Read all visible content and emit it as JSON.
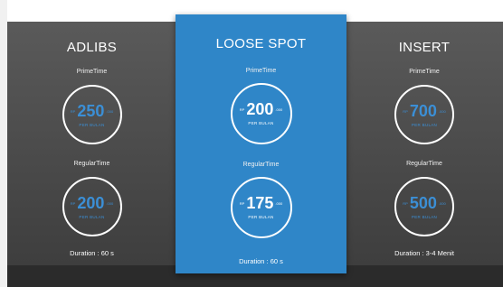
{
  "columns": [
    {
      "title": "ADLIBS",
      "prime_label": "PrimeTime",
      "prime": {
        "prefix": "RP",
        "value": "250",
        "suffix": ".000",
        "per": "PER BULAN"
      },
      "regular_label": "RegularTime",
      "regular": {
        "prefix": "RP",
        "value": "200",
        "suffix": ".000",
        "per": "PER BULAN"
      },
      "duration": "Duration : 60 s"
    },
    {
      "title": "LOOSE SPOT",
      "prime_label": "PrimeTime",
      "prime": {
        "prefix": "RP",
        "value": "200",
        "suffix": ".000",
        "per": "PER BULAN"
      },
      "regular_label": "RegularTime",
      "regular": {
        "prefix": "RP",
        "value": "175",
        "suffix": ".000",
        "per": "PER BULAN"
      },
      "duration": "Duration : 60 s"
    },
    {
      "title": "INSERT",
      "prime_label": "PrimeTime",
      "prime": {
        "prefix": "RP",
        "value": "700",
        "suffix": ".000",
        "per": "PER BULAN"
      },
      "regular_label": "RegularTime",
      "regular": {
        "prefix": "RP",
        "value": "500",
        "suffix": ".000",
        "per": "PER BULAN"
      },
      "duration": "Duration : 3-4 Menit"
    }
  ],
  "colors": {
    "highlight": "#2f86c8",
    "dark": "#4b4b4b",
    "price_blue": "#3b8fd6"
  }
}
